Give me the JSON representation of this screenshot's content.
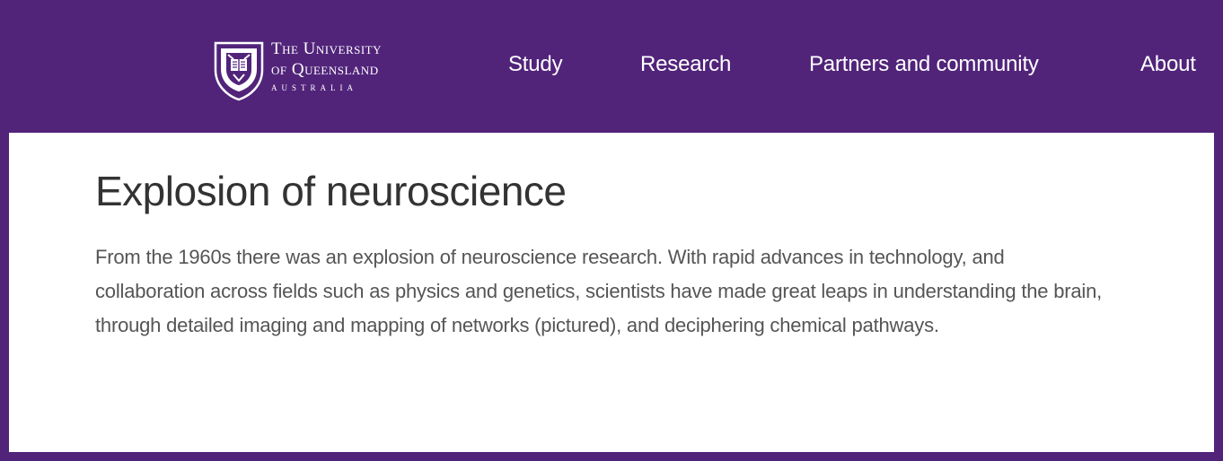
{
  "header": {
    "logo": {
      "line1": "The University",
      "line2": "of Queensland",
      "line3": "AUSTRALIA"
    },
    "nav": [
      {
        "label": "Study"
      },
      {
        "label": "Research"
      },
      {
        "label": "Partners and community"
      },
      {
        "label": "About"
      }
    ]
  },
  "content": {
    "title": "Explosion of neuroscience",
    "body": "From the 1960s there was an explosion of neuroscience research. With rapid advances in technology, and collaboration across fields such as physics and genetics, scientists have made great leaps in understanding the brain, through detailed imaging and mapping of networks (pictured), and deciphering chemical pathways."
  },
  "colors": {
    "brand_purple": "#51247a",
    "panel_white": "#ffffff",
    "title_text": "#333333",
    "body_text": "#555555"
  },
  "icons": {
    "logo_crest": "university-crest-icon"
  }
}
